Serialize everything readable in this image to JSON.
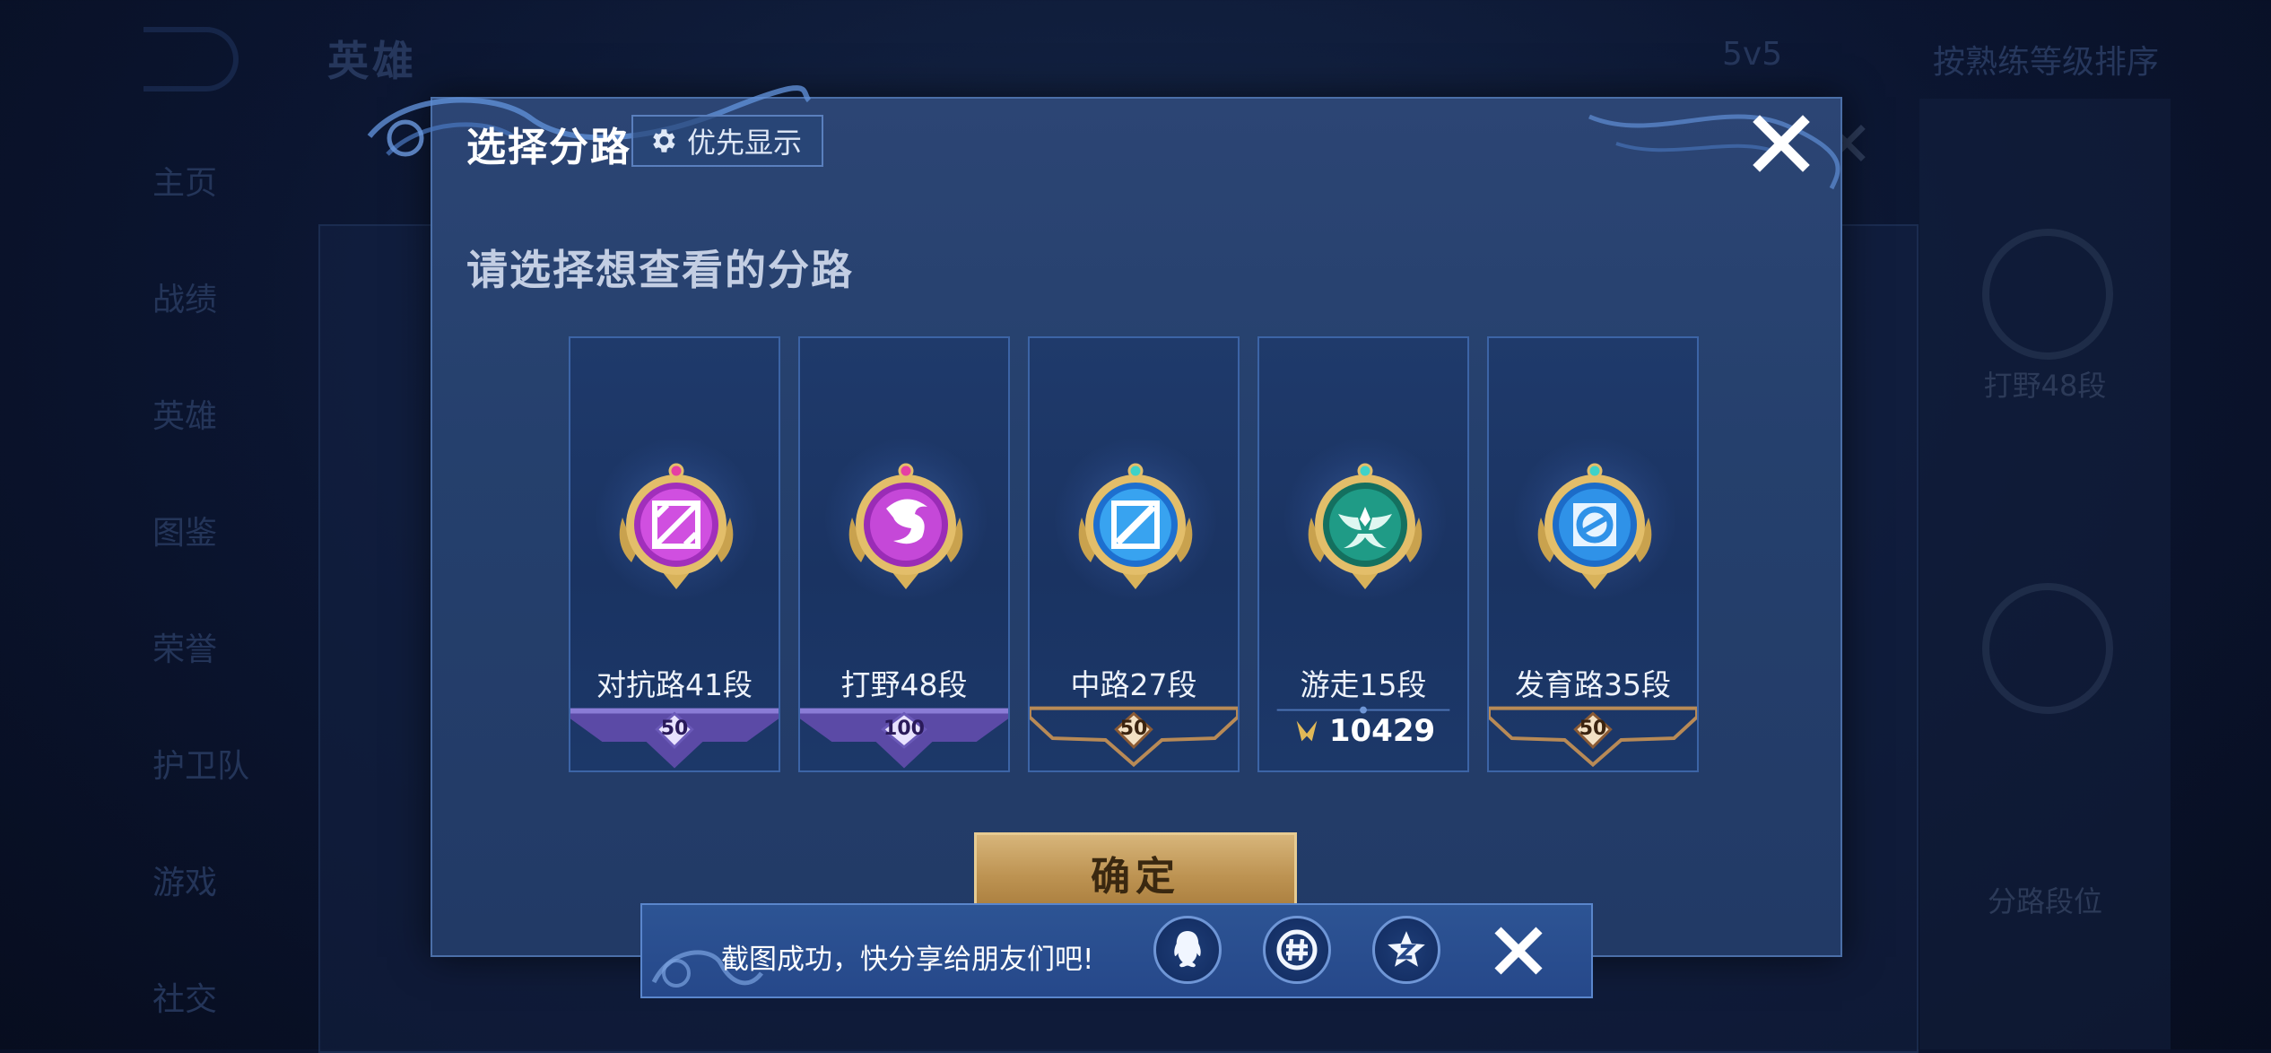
{
  "background": {
    "title": "英雄",
    "mode": "5v5",
    "sort": "按熟练等级排序",
    "nav": [
      "主页",
      "战绩",
      "英雄",
      "图鉴",
      "荣誉",
      "护卫队",
      "游戏",
      "社交"
    ],
    "right_panel": {
      "emblem_label": "打野48段",
      "lane_label": "分路段位"
    }
  },
  "dialog": {
    "title": "选择分路",
    "priority_label": "优先显示",
    "subtitle": "请选择想查看的分路",
    "confirm_label": "确定"
  },
  "lanes": [
    {
      "rank": "对抗路41段",
      "badge": "50",
      "plate": "purple",
      "emblem": "clash-lane-icon",
      "color": "#c53bd6"
    },
    {
      "rank": "打野48段",
      "badge": "100",
      "plate": "purple",
      "emblem": "dragon-jungle-icon",
      "color": "#b43ad0"
    },
    {
      "rank": "中路27段",
      "badge": "50",
      "plate": "gold",
      "emblem": "mid-lane-icon",
      "color": "#2f8fe8"
    },
    {
      "rank": "游走15段",
      "points": "10429",
      "plate": "none",
      "emblem": "roam-wings-icon",
      "color": "#1f9b86"
    },
    {
      "rank": "发育路35段",
      "badge": "50",
      "plate": "gold",
      "emblem": "farm-lane-icon",
      "color": "#2a8be0"
    }
  ],
  "toast": {
    "message": "截图成功，快分享给朋友们吧!",
    "share_targets": [
      "qq-icon",
      "wechat-moments-icon",
      "qzone-icon"
    ]
  }
}
